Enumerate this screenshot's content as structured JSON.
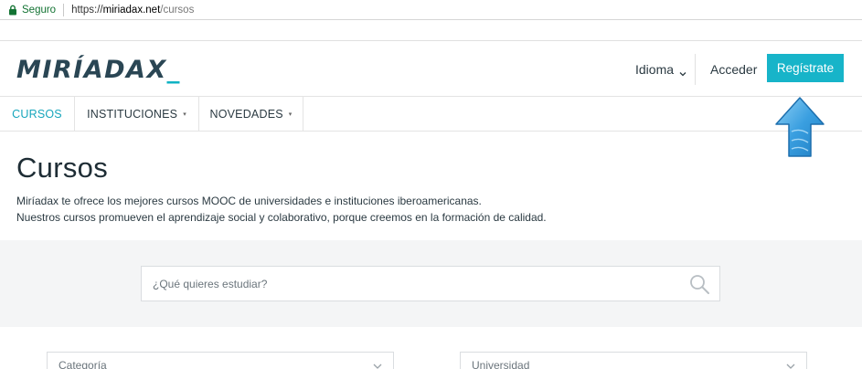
{
  "browser": {
    "secure_label": "Seguro",
    "url_scheme": "https://",
    "url_host": "miriadax.net",
    "url_path": "/cursos"
  },
  "header": {
    "logo_text": "MIRÍADAX",
    "logo_suffix": "_",
    "language_label": "Idioma",
    "login_label": "Acceder",
    "register_label": "Regístrate"
  },
  "nav": {
    "items": [
      {
        "label": "CURSOS",
        "active": true
      },
      {
        "label": "INSTITUCIONES",
        "active": false
      },
      {
        "label": "NOVEDADES",
        "active": false
      }
    ]
  },
  "main": {
    "title": "Cursos",
    "intro_line_1": "Miríadax te ofrece los mejores cursos MOOC de universidades e instituciones iberoamericanas.",
    "intro_line_2": "Nuestros cursos promueven el aprendizaje social y colaborativo, porque creemos en  la formación de calidad."
  },
  "search": {
    "placeholder": "¿Qué quieres estudiar?"
  },
  "filters": {
    "category_placeholder": "Categoría",
    "university_placeholder": "Universidad"
  },
  "colors": {
    "accent": "#17b4c9",
    "brand_dark": "#2a4654",
    "arrow": "#3a9fe0"
  },
  "icons": {
    "lock": "lock-icon",
    "search": "search-icon",
    "chevron": "chevron-down-icon",
    "arrow": "arrow-up-icon"
  }
}
